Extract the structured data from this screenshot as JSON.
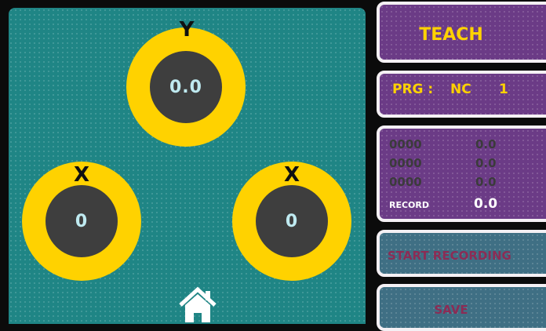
{
  "dials": {
    "y": {
      "label": "Y",
      "value": "0.0"
    },
    "x_left": {
      "label": "X",
      "value": "0"
    },
    "x_right": {
      "label": "X",
      "value": "0"
    }
  },
  "home": {
    "icon": "home-icon"
  },
  "teach": {
    "label": "TEACH"
  },
  "program": {
    "prefix": "PRG :",
    "mode": "NC",
    "number": "1"
  },
  "readouts": [
    {
      "code": "0000",
      "value": "0.0"
    },
    {
      "code": "0000",
      "value": "0.0"
    },
    {
      "code": "0000",
      "value": "0.0"
    }
  ],
  "record": {
    "label": "RECORD",
    "value": "0.0"
  },
  "buttons": {
    "start_recording": "START RECORDING",
    "save": "SAVE"
  },
  "colors": {
    "panel_teal": "#1f8585",
    "dial_yellow": "#ffd200",
    "dial_dark": "#3e3e3e",
    "purple": "#6b3b86",
    "button_teal": "#3f6f84",
    "button_text": "#8b2c55"
  }
}
